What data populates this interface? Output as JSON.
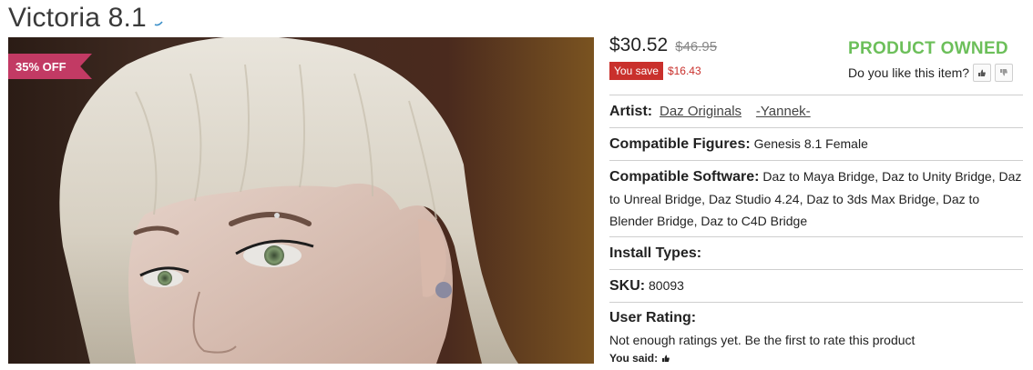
{
  "product": {
    "title": "Victoria 8.1",
    "discount_badge": "35% OFF",
    "price": "$30.52",
    "old_price": "$46.95",
    "you_save_label": "You save",
    "save_amount": "$16.43",
    "owned_label": "PRODUCT OWNED",
    "like_question": "Do you like this item?"
  },
  "info": {
    "artist_label": "Artist:",
    "artists": [
      "Daz Originals",
      "-Yannek-"
    ],
    "figures_label": "Compatible Figures:",
    "figures_value": "Genesis 8.1 Female",
    "software_label": "Compatible Software:",
    "software_value": "Daz to Maya Bridge, Daz to Unity Bridge, Daz to Unreal Bridge, Daz Studio 4.24, Daz to 3ds Max Bridge, Daz to Blender Bridge, Daz to C4D Bridge",
    "install_label": "Install Types:",
    "sku_label": "SKU:",
    "sku_value": "80093",
    "rating_label": "User Rating:",
    "rating_text": "Not enough ratings yet. Be the first to rate this product",
    "you_said_label": "You said:"
  },
  "icons": {
    "title_icon": "badge-icon",
    "thumb_up": "thumbs-up-icon",
    "thumb_down": "thumbs-down-icon"
  },
  "colors": {
    "badge": "#c23a64",
    "owned": "#6cbf5a",
    "save": "#c9302c"
  }
}
